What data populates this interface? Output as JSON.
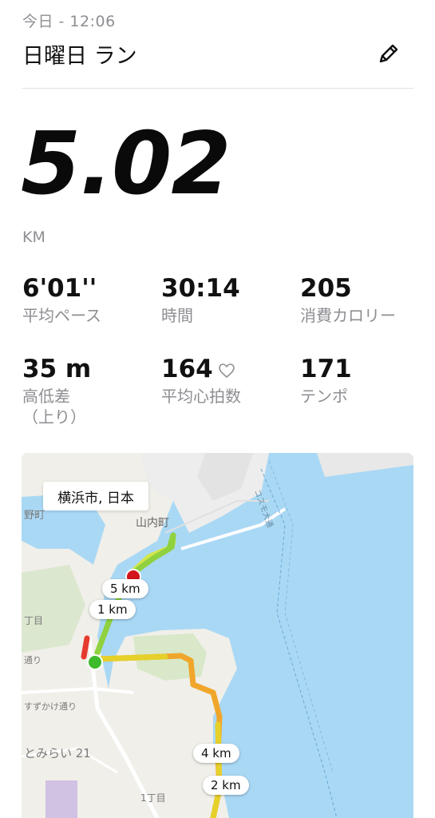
{
  "header": {
    "date_label": "今日 - 12:06",
    "title": "日曜日 ラン",
    "edit_icon": "pencil-icon"
  },
  "summary": {
    "distance": "5.02",
    "distance_unit": "KM"
  },
  "stats": [
    {
      "value": "6'01''",
      "label": "平均ペース"
    },
    {
      "value": "30:14",
      "label": "時間"
    },
    {
      "value": "205",
      "label": "消費カロリー"
    },
    {
      "value": "35 m",
      "label": "高低差\n（上り）"
    },
    {
      "value": "164",
      "label": "平均心拍数",
      "icon": "heart-outline-icon"
    },
    {
      "value": "171",
      "label": "テンポ"
    }
  ],
  "map": {
    "location_badge": "横浜市, 日本",
    "place_labels": [
      "山内町",
      "すずかけ通り",
      "とみらい 21",
      "1丁目",
      "丁目",
      "通り",
      "野町",
      "コスモ大通"
    ],
    "km_markers": [
      "5 km",
      "1 km",
      "4 km",
      "2 km"
    ],
    "colors": {
      "water": "#a9d8f5",
      "land": "#f0efe9",
      "park": "#d8e8c8",
      "route_green": "#8fd13f",
      "route_yellow": "#e6d02a",
      "route_orange": "#f0a62a",
      "route_red": "#e63a2e",
      "start_marker": "#3dbb2b",
      "end_marker": "#d3141b"
    }
  }
}
